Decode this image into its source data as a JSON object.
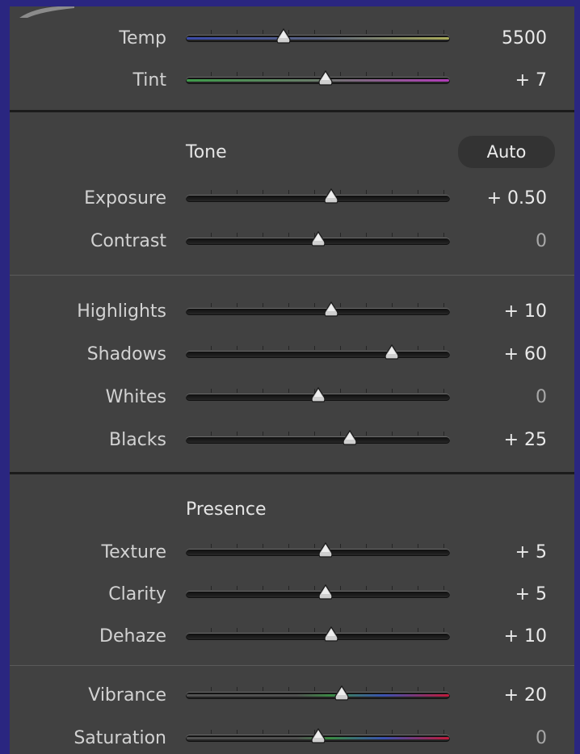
{
  "wb_section": {
    "sliders": [
      {
        "label": "Temp",
        "value": "5500",
        "position": 0.37,
        "fill": "linear-gradient(90deg,#3a4aa8,#59627e 50%,#a8aa5a)"
      },
      {
        "label": "Tint",
        "value": "+ 7",
        "position": 0.53,
        "fill": "linear-gradient(90deg,#3e9a4a,#6a7a6a 50%,#b03cb8)"
      }
    ]
  },
  "tone_section": {
    "title": "Tone",
    "auto_label": "Auto",
    "sliders": [
      {
        "label": "Exposure",
        "value": "+ 0.50",
        "position": 0.55
      },
      {
        "label": "Contrast",
        "value": "0",
        "position": 0.5
      }
    ],
    "sliders2": [
      {
        "label": "Highlights",
        "value": "+ 10",
        "position": 0.55
      },
      {
        "label": "Shadows",
        "value": "+ 60",
        "position": 0.78
      },
      {
        "label": "Whites",
        "value": "0",
        "position": 0.5
      },
      {
        "label": "Blacks",
        "value": "+ 25",
        "position": 0.62
      }
    ]
  },
  "presence_section": {
    "title": "Presence",
    "sliders": [
      {
        "label": "Texture",
        "value": "+ 5",
        "position": 0.53
      },
      {
        "label": "Clarity",
        "value": "+ 5",
        "position": 0.53
      },
      {
        "label": "Dehaze",
        "value": "+ 10",
        "position": 0.55
      }
    ],
    "sliders2": [
      {
        "label": "Vibrance",
        "value": "+ 20",
        "position": 0.59,
        "fill": "linear-gradient(90deg,#505050,#505050 42%,#3a8a44 55%,#3a52b0 75%,#c01a3a)"
      },
      {
        "label": "Saturation",
        "value": "0",
        "position": 0.5,
        "fill": "linear-gradient(90deg,#505050,#505050 42%,#3a8a44 55%,#3a52b0 75%,#c01a3a)"
      }
    ]
  },
  "colors": {
    "panel": "#414141",
    "frame": "#2a2680",
    "text": "#d2d2d2"
  },
  "icons": {
    "corner": "brush-icon"
  }
}
